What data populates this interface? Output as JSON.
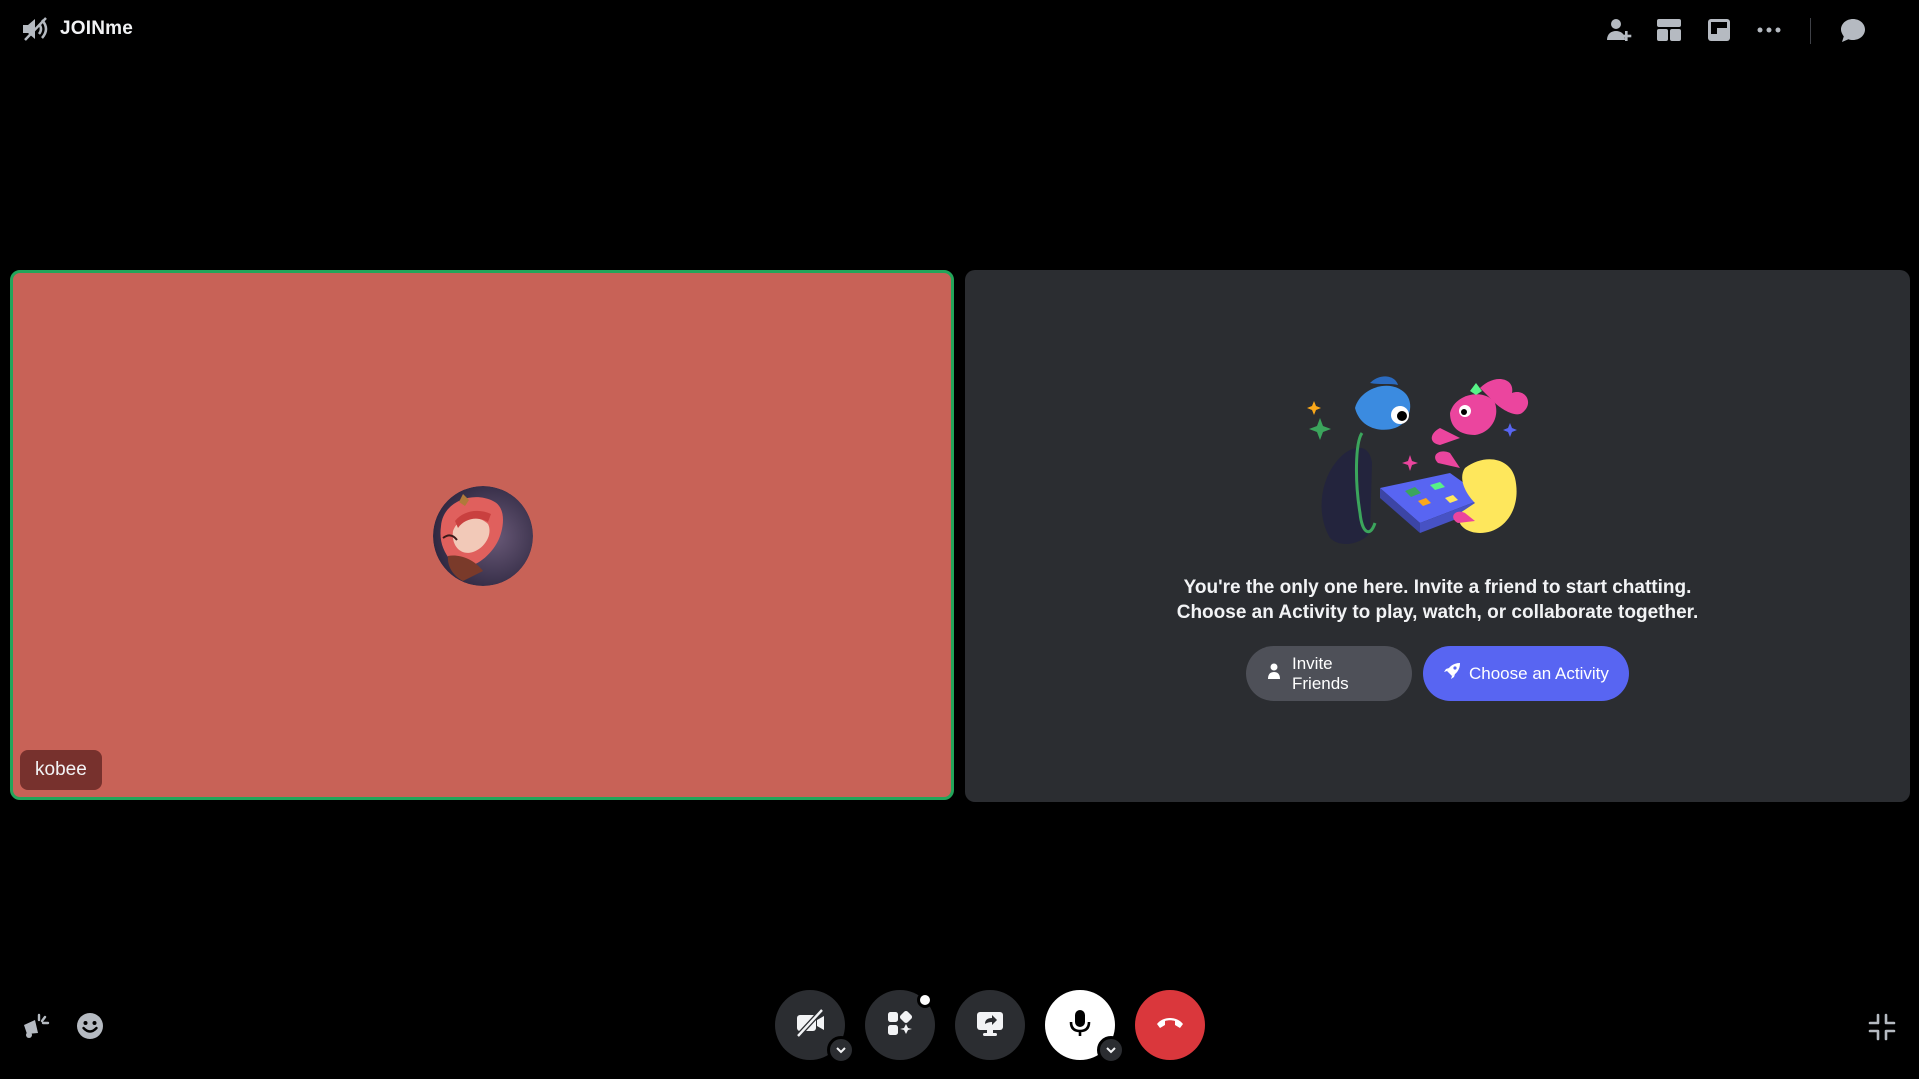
{
  "header": {
    "channel_name": "JOINme",
    "channel_icon": "speaker-muted-icon",
    "actions": [
      {
        "name": "add-user-icon",
        "label": "Invite"
      },
      {
        "name": "layout-icon",
        "label": "Layout"
      },
      {
        "name": "popout-icon",
        "label": "Pop Out"
      },
      {
        "name": "more-options-icon",
        "label": "More"
      },
      {
        "name": "chat-icon",
        "label": "Chat"
      }
    ]
  },
  "participant": {
    "name": "kobee",
    "tile_color": "#c86257",
    "speaking_border": "#23a55a"
  },
  "empty_state": {
    "line1": "You're the only one here. Invite a friend to start chatting.",
    "line2": "Choose an Activity to play, watch, or collaborate together.",
    "invite_label": "Invite Friends",
    "activity_label": "Choose an Activity"
  },
  "controls": {
    "camera": "camera-off-icon",
    "activities": "activities-icon",
    "screen_share": "screen-share-icon",
    "microphone": "microphone-icon",
    "disconnect": "hang-up-icon"
  },
  "colors": {
    "background": "#000000",
    "panel": "#2b2d31",
    "blurple": "#5865f2",
    "grey_button": "#4e5058",
    "danger": "#da373c"
  }
}
